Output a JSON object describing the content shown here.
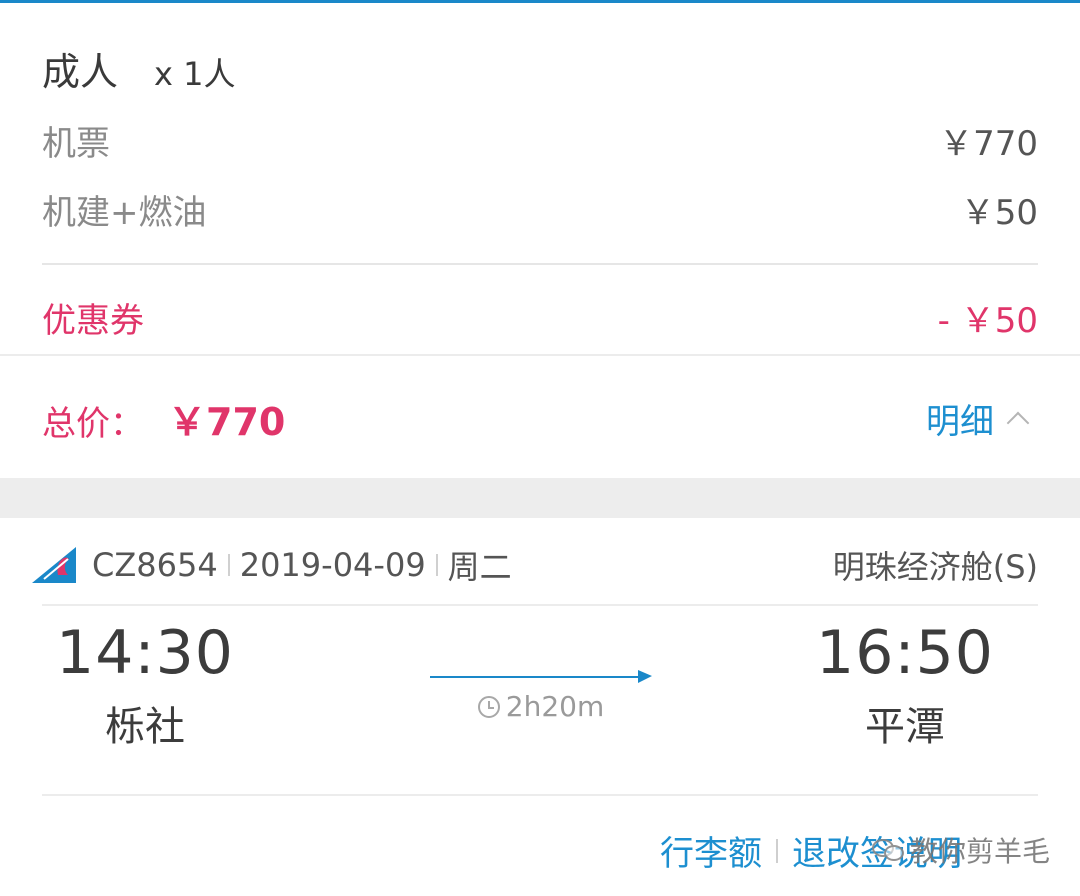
{
  "passenger": {
    "type_label": "成人",
    "count_label": "x 1人"
  },
  "fees": [
    {
      "label": "机票",
      "value": "￥770"
    },
    {
      "label": "机建+燃油",
      "value": "￥50"
    }
  ],
  "coupon": {
    "label": "优惠券",
    "value": "- ￥50"
  },
  "total": {
    "label": "总价：",
    "value": "￥770",
    "detail_label": "明细"
  },
  "flight": {
    "number": "CZ8654",
    "date": "2019-04-09",
    "weekday": "周二",
    "cabin": "明珠经济舱(S)",
    "departure": {
      "time": "14:30",
      "city": "栎社"
    },
    "arrival": {
      "time": "16:50",
      "city": "平潭"
    },
    "duration": "2h20m"
  },
  "footer": {
    "baggage_label": "行李额",
    "refund_label": "退改签说明"
  },
  "watermark": {
    "text": "教你剪羊毛"
  },
  "colors": {
    "accent_blue": "#1a88c9",
    "price_red": "#e0356a"
  }
}
